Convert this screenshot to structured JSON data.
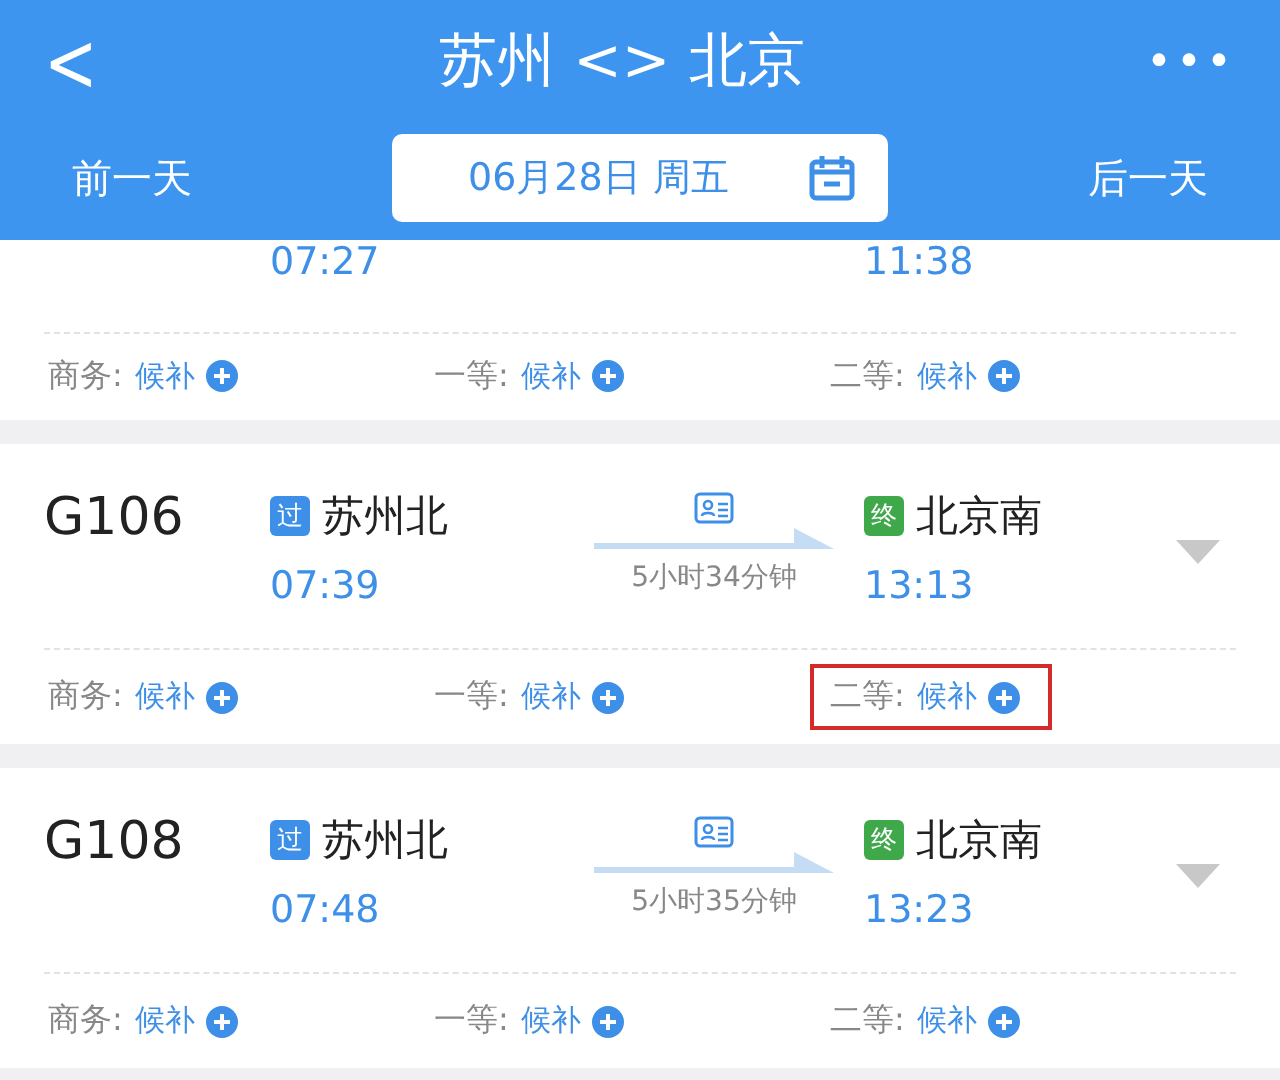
{
  "header": {
    "back": "<",
    "title": "苏州 <> 北京",
    "more": "•••"
  },
  "date_bar": {
    "prev": "前一天",
    "date": "06月28日 周五",
    "next": "后一天"
  },
  "trains": [
    {
      "depart": "07:27",
      "arrive": "11:38",
      "expandable": false,
      "seats": [
        {
          "label": "商务:",
          "status": "候补",
          "highlighted": false
        },
        {
          "label": "一等:",
          "status": "候补",
          "highlighted": false
        },
        {
          "label": "二等:",
          "status": "候补",
          "highlighted": false
        }
      ]
    },
    {
      "number": "G106",
      "from": {
        "badge": "过",
        "name": "苏州北",
        "color": "#3d8fe8"
      },
      "to": {
        "badge": "终",
        "name": "北京南",
        "color": "#3fa84a"
      },
      "depart": "07:39",
      "arrive": "13:13",
      "duration": "5小时34分钟",
      "expandable": true,
      "seats": [
        {
          "label": "商务:",
          "status": "候补",
          "highlighted": false
        },
        {
          "label": "一等:",
          "status": "候补",
          "highlighted": false
        },
        {
          "label": "二等:",
          "status": "候补",
          "highlighted": true
        }
      ]
    },
    {
      "number": "G108",
      "from": {
        "badge": "过",
        "name": "苏州北",
        "color": "#3d8fe8"
      },
      "to": {
        "badge": "终",
        "name": "北京南",
        "color": "#3fa84a"
      },
      "depart": "07:48",
      "arrive": "13:23",
      "duration": "5小时35分钟",
      "expandable": true,
      "seats": [
        {
          "label": "商务:",
          "status": "候补",
          "highlighted": false
        },
        {
          "label": "一等:",
          "status": "候补",
          "highlighted": false
        },
        {
          "label": "二等:",
          "status": "候补",
          "highlighted": false
        }
      ]
    }
  ]
}
